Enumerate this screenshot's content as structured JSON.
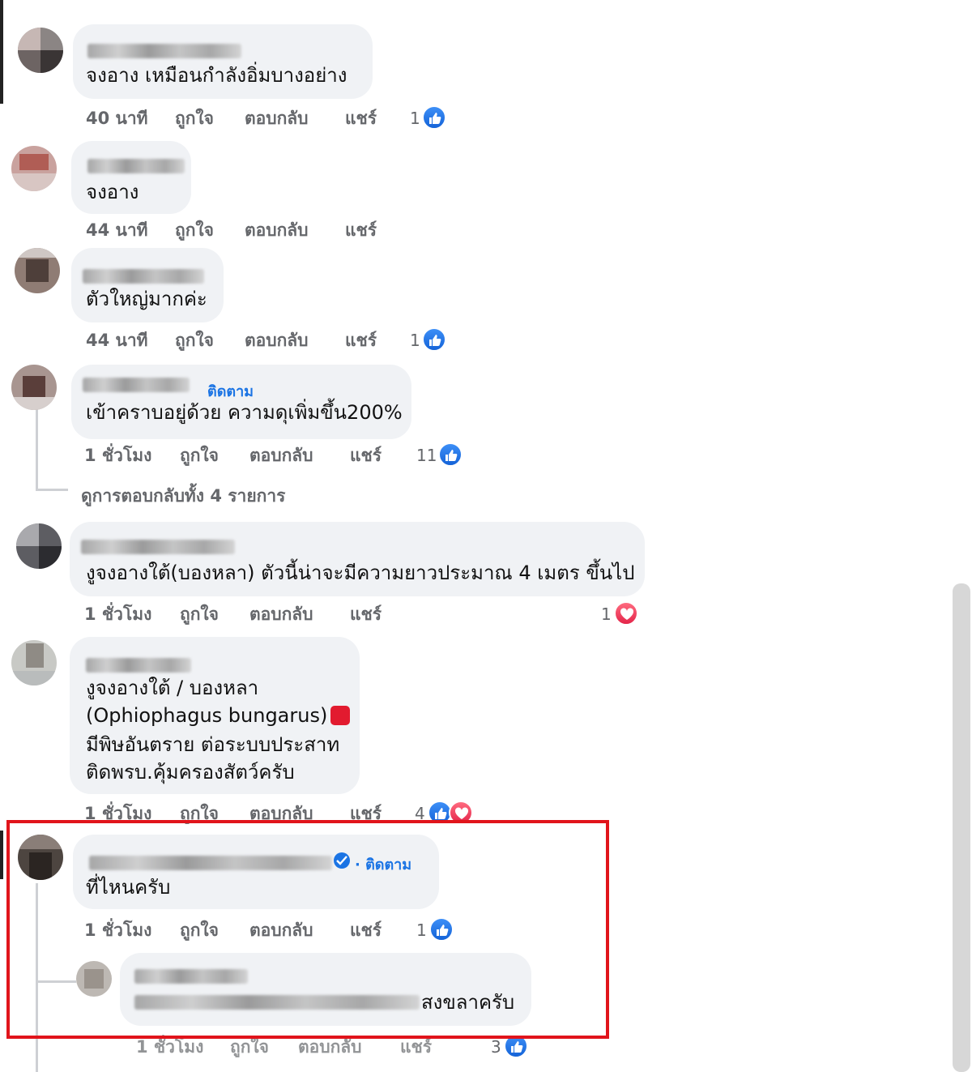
{
  "comments": [
    {
      "text": "จงอาง เหมือนกำลังอิ่มบางอย่าง",
      "time": "40 นาที",
      "like": "ถูกใจ",
      "reply": "ตอบกลับ",
      "share": "แชร์",
      "reactions": "1"
    },
    {
      "text": "จงอาง",
      "time": "44 นาที",
      "like": "ถูกใจ",
      "reply": "ตอบกลับ",
      "share": "แชร์",
      "reactions": ""
    },
    {
      "text": "ตัวใหญ่มากค่ะ",
      "time": "44 นาที",
      "like": "ถูกใจ",
      "reply": "ตอบกลับ",
      "share": "แชร์",
      "reactions": "1"
    },
    {
      "follow": "ติดตาม",
      "text": "เข้าคราบอยู่ด้วย ความดุเพิ่มขึ้น200%",
      "time": "1 ชั่วโมง",
      "like": "ถูกใจ",
      "reply": "ตอบกลับ",
      "share": "แชร์",
      "reactions": "11",
      "view_replies": "ดูการตอบกลับทั้ง 4 รายการ"
    },
    {
      "text": "งูจงอางใต้(บองหลา) ตัวนี้น่าจะมีความยาวประมาณ 4 เมตร ขึ้นไป",
      "time": "1 ชั่วโมง",
      "like": "ถูกใจ",
      "reply": "ตอบกลับ",
      "share": "แชร์",
      "reactions": "1"
    },
    {
      "lines": [
        "งูจงอางใต้ / บองหลา",
        "(Ophiophagus bungarus)",
        "มีพิษอันตราย ต่อระบบประสาท",
        "ติดพรบ.คุ้มครองสัตว์ครับ"
      ],
      "time": "1 ชั่วโมง",
      "like": "ถูกใจ",
      "reply": "ตอบกลับ",
      "share": "แชร์",
      "reactions": "4"
    },
    {
      "follow": "· ติดตาม",
      "text": "ที่ไหนครับ",
      "time": "1 ชั่วโมง",
      "like": "ถูกใจ",
      "reply": "ตอบกลับ",
      "share": "แชร์",
      "reactions": "1"
    },
    {
      "text": "สงขลาครับ",
      "time": "1 ชั่วโมง",
      "like": "ถูกใจ",
      "reply": "ตอบกลับ",
      "share": "แชร์",
      "reactions": "3"
    }
  ],
  "colors": {
    "bubble": "#f0f2f5",
    "meta_text": "#65676b",
    "link_blue": "#1b74e4",
    "highlight_red": "#e1141b"
  },
  "icons": {
    "like": "like-icon",
    "love": "love-icon",
    "verified": "verified-badge-icon"
  }
}
